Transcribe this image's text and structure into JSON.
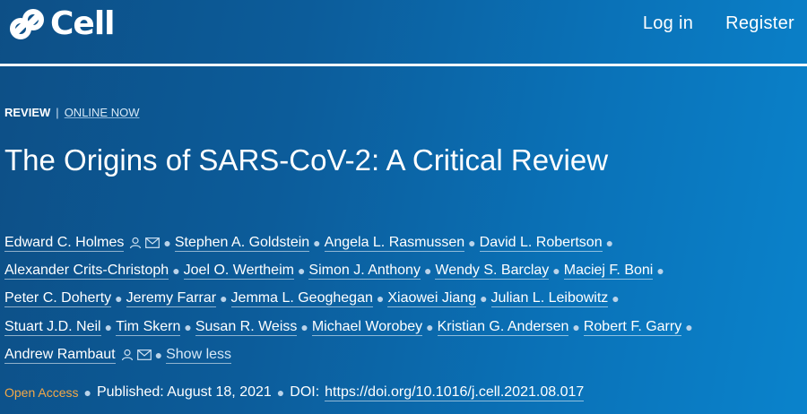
{
  "header": {
    "logo_text": "Cell",
    "login_label": "Log in",
    "register_label": "Register"
  },
  "article": {
    "type_label": "REVIEW",
    "separator": "|",
    "status_label": "ONLINE NOW",
    "title": "The Origins of SARS-CoV-2: A Critical Review",
    "author_lines": [
      [
        "Edward C. Holmes",
        "Stephen A. Goldstein",
        "Angela L. Rasmussen",
        "David L. Robertson"
      ],
      [
        "Alexander Crits-Christoph",
        "Joel O. Wertheim",
        "Simon J. Anthony",
        "Wendy S. Barclay",
        "Maciej F. Boni"
      ],
      [
        "Peter C. Doherty",
        "Jeremy Farrar",
        "Jemma L. Geoghegan",
        "Xiaowei Jiang",
        "Julian L. Leibowitz"
      ],
      [
        "Stuart J.D. Neil",
        "Tim Skern",
        "Susan R. Weiss",
        "Michael Worobey",
        "Kristian G. Andersen",
        "Robert F. Garry"
      ],
      [
        "Andrew Rambaut"
      ]
    ],
    "show_less_label": "Show less",
    "open_access_label": "Open Access",
    "published_label": "Published: August 18, 2021",
    "doi_label": "DOI:",
    "doi_link": "https://doi.org/10.1016/j.cell.2021.08.017"
  },
  "icons": {
    "logo": "cell-logo-icon",
    "person": "person-icon",
    "mail": "mail-icon"
  },
  "colors": {
    "background_start": "#0d4f86",
    "background_end": "#0a83cc",
    "open_access": "#f3a847"
  }
}
